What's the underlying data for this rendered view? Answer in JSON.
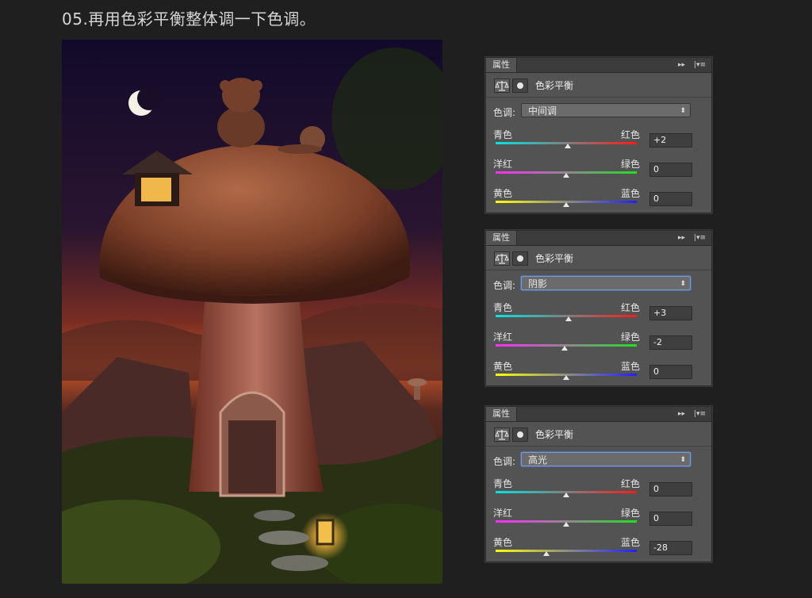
{
  "step_title": "05.再用色彩平衡整体调一下色调。",
  "panels": [
    {
      "tab": "属性",
      "name": "色彩平衡",
      "tone_label": "色调:",
      "tone_value": "中间调",
      "focused": false,
      "sliders": [
        {
          "left": "青色",
          "right": "红色",
          "value": "+2",
          "level": 2,
          "track": "cyan-red"
        },
        {
          "left": "洋红",
          "right": "绿色",
          "value": "0",
          "level": 0,
          "track": "mag-green"
        },
        {
          "left": "黄色",
          "right": "蓝色",
          "value": "0",
          "level": 0,
          "track": "yel-blue"
        }
      ]
    },
    {
      "tab": "属性",
      "name": "色彩平衡",
      "tone_label": "色调:",
      "tone_value": "阴影",
      "focused": true,
      "sliders": [
        {
          "left": "青色",
          "right": "红色",
          "value": "+3",
          "level": 3,
          "track": "cyan-red"
        },
        {
          "left": "洋红",
          "right": "绿色",
          "value": "-2",
          "level": -2,
          "track": "mag-green"
        },
        {
          "left": "黄色",
          "right": "蓝色",
          "value": "0",
          "level": 0,
          "track": "yel-blue"
        }
      ]
    },
    {
      "tab": "属性",
      "name": "色彩平衡",
      "tone_label": "色调:",
      "tone_value": "高光",
      "focused": true,
      "sliders": [
        {
          "left": "青色",
          "right": "红色",
          "value": "0",
          "level": 0,
          "track": "cyan-red"
        },
        {
          "left": "洋红",
          "right": "绿色",
          "value": "0",
          "level": 0,
          "track": "mag-green"
        },
        {
          "left": "黄色",
          "right": "蓝色",
          "value": "-28",
          "level": -28,
          "track": "yel-blue"
        }
      ]
    }
  ],
  "icons": {
    "tab_collapse": "double-arrow-right-icon",
    "tab_menu": "panel-menu-icon",
    "adjustment": "balance-scale-icon",
    "mask": "layer-mask-icon"
  },
  "colors": {
    "background": "#1f1f1f",
    "panel": "#535353",
    "panel_dark": "#3c3c3c",
    "text": "#e6e6e6"
  }
}
